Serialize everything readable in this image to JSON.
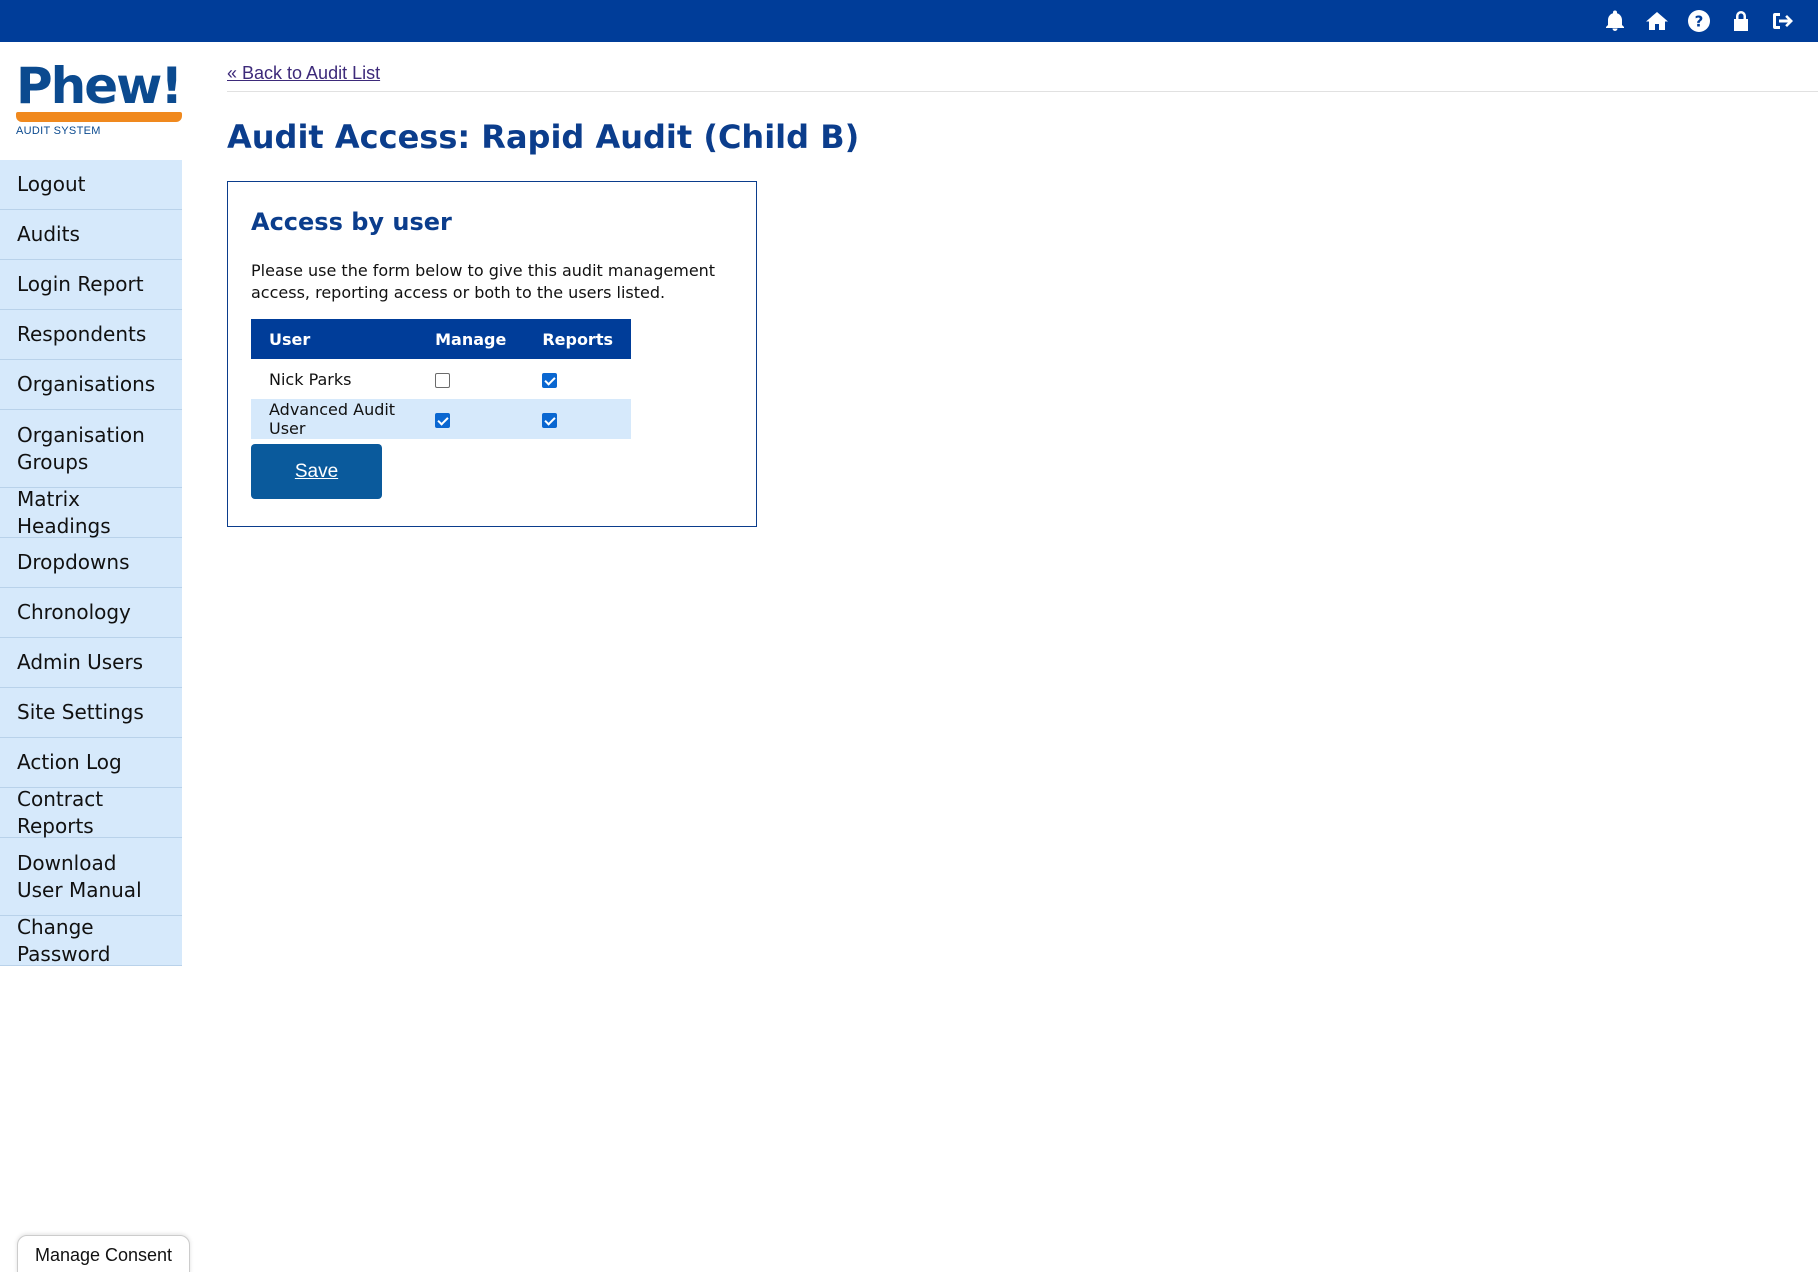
{
  "colors": {
    "brand": "#003d99",
    "accent": "#f0891e",
    "nav_bg": "#d6e9fb",
    "button": "#0a5a9c"
  },
  "topbar": {
    "icons": [
      "bell-icon",
      "home-icon",
      "help-icon",
      "lock-icon",
      "logout-icon"
    ]
  },
  "logo": {
    "word": "Phew!",
    "sub": "AUDIT SYSTEM"
  },
  "sidebar": {
    "items": [
      {
        "label": "Logout"
      },
      {
        "label": "Audits"
      },
      {
        "label": "Login Report"
      },
      {
        "label": "Respondents"
      },
      {
        "label": "Organisations"
      },
      {
        "label": "Organisation Groups"
      },
      {
        "label": "Matrix Headings"
      },
      {
        "label": "Dropdowns"
      },
      {
        "label": "Chronology"
      },
      {
        "label": "Admin Users"
      },
      {
        "label": "Site Settings"
      },
      {
        "label": "Action Log"
      },
      {
        "label": "Contract Reports"
      },
      {
        "label": "Download User Manual"
      },
      {
        "label": "Change Password"
      }
    ]
  },
  "main": {
    "back_link": "« Back to Audit List",
    "title": "Audit Access: Rapid Audit (Child B)",
    "panel": {
      "heading": "Access by user",
      "description": "Please use the form below to give this audit management access, reporting access or both to the users listed.",
      "columns": [
        "User",
        "Manage",
        "Reports"
      ],
      "rows": [
        {
          "user": "Nick Parks",
          "manage": false,
          "reports": true
        },
        {
          "user": "Advanced Audit User",
          "manage": true,
          "reports": true
        }
      ],
      "save_label": "Save"
    }
  },
  "consent": {
    "label": "Manage Consent"
  }
}
